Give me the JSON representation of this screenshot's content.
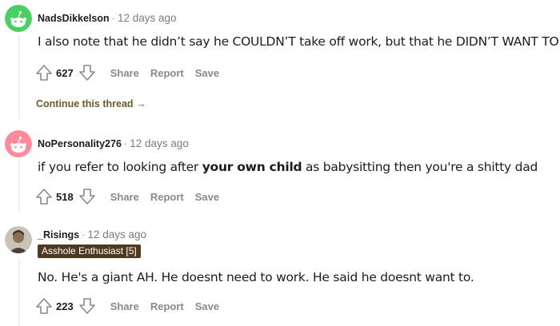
{
  "comments": [
    {
      "username": "NadsDikkelson",
      "time": "12 days ago",
      "body_parts": [
        "I also note that he didn’t say he COULDN’T take off work, but that he DIDN’T WANT TO"
      ],
      "score": "627",
      "share": "Share",
      "report": "Report",
      "save": "Save",
      "continue": "Continue this thread",
      "avatar_color": "#46d160"
    },
    {
      "username": "NoPersonality276",
      "time": "12 days ago",
      "body_parts": [
        "if you refer to looking after ",
        "your own child",
        " as babysitting then you're a shitty dad"
      ],
      "score": "518",
      "share": "Share",
      "report": "Report",
      "save": "Save",
      "avatar_color": "#ff8a9a"
    },
    {
      "username": "_Risings",
      "time": "12 days ago",
      "flair": "Asshole Enthusiast [5]",
      "body_parts": [
        "No. He's a giant AH. He doesnt need to work. He said he doesnt want to."
      ],
      "score": "223",
      "share": "Share",
      "report": "Report",
      "save": "Save"
    }
  ],
  "icons": {
    "upvote": "upvote-arrow-icon",
    "downvote": "downvote-arrow-icon",
    "continue_arrow": "arrow-right-icon"
  },
  "colors": {
    "meta_gray": "#878a8c",
    "continue_link": "#6a5a2a",
    "flair_bg": "#4f3a1f"
  }
}
